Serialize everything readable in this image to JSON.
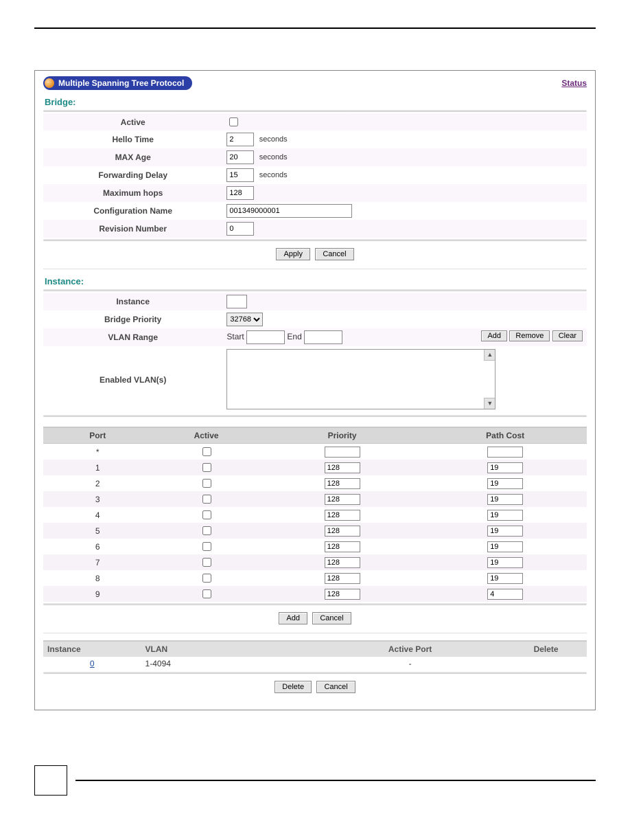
{
  "header": {
    "title": "Multiple Spanning Tree Protocol",
    "status_link": "Status"
  },
  "sections": {
    "bridge_heading": "Bridge:",
    "instance_heading": "Instance:"
  },
  "bridge": {
    "active_label": "Active",
    "hello_time_label": "Hello Time",
    "hello_time_value": "2",
    "hello_time_unit": "seconds",
    "max_age_label": "MAX Age",
    "max_age_value": "20",
    "max_age_unit": "seconds",
    "forwarding_delay_label": "Forwarding Delay",
    "forwarding_delay_value": "15",
    "forwarding_delay_unit": "seconds",
    "max_hops_label": "Maximum hops",
    "max_hops_value": "128",
    "config_name_label": "Configuration Name",
    "config_name_value": "001349000001",
    "revision_label": "Revision Number",
    "revision_value": "0"
  },
  "buttons": {
    "apply": "Apply",
    "cancel": "Cancel",
    "add": "Add",
    "remove": "Remove",
    "clear": "Clear",
    "delete": "Delete"
  },
  "instance": {
    "instance_label": "Instance",
    "instance_value": "",
    "bridge_priority_label": "Bridge Priority",
    "bridge_priority_value": "32768",
    "vlan_range_label": "VLAN Range",
    "vlan_start_label": "Start",
    "vlan_end_label": "End",
    "enabled_vlans_label": "Enabled VLAN(s)"
  },
  "port_columns": {
    "port": "Port",
    "active": "Active",
    "priority": "Priority",
    "path_cost": "Path Cost"
  },
  "ports": [
    {
      "port": "*",
      "priority": "",
      "path_cost": ""
    },
    {
      "port": "1",
      "priority": "128",
      "path_cost": "19"
    },
    {
      "port": "2",
      "priority": "128",
      "path_cost": "19"
    },
    {
      "port": "3",
      "priority": "128",
      "path_cost": "19"
    },
    {
      "port": "4",
      "priority": "128",
      "path_cost": "19"
    },
    {
      "port": "5",
      "priority": "128",
      "path_cost": "19"
    },
    {
      "port": "6",
      "priority": "128",
      "path_cost": "19"
    },
    {
      "port": "7",
      "priority": "128",
      "path_cost": "19"
    },
    {
      "port": "8",
      "priority": "128",
      "path_cost": "19"
    },
    {
      "port": "9",
      "priority": "128",
      "path_cost": "4"
    }
  ],
  "summary_columns": {
    "instance": "Instance",
    "vlan": "VLAN",
    "active_port": "Active Port",
    "delete": "Delete"
  },
  "summary_row": {
    "instance": "0",
    "vlan": "1-4094",
    "active_port": "-"
  }
}
